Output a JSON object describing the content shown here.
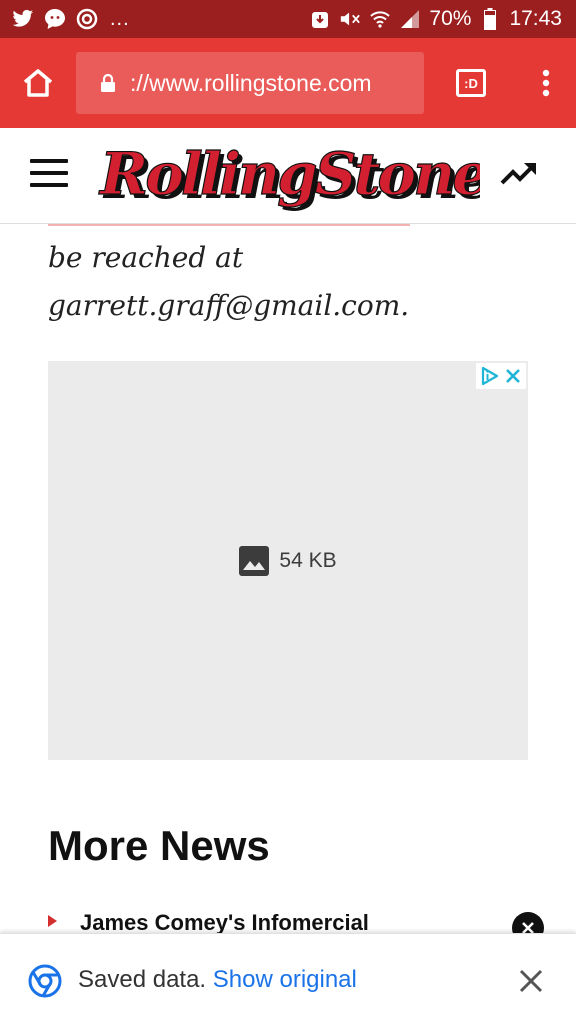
{
  "status_bar": {
    "battery": "70%",
    "time": "17:43",
    "more": "...",
    "left_icons": [
      "twitter-icon",
      "chat-icon",
      "sync-icon"
    ],
    "right_icons": [
      "download-icon",
      "mute-icon",
      "wifi-icon",
      "signal-icon",
      "battery-icon"
    ]
  },
  "browser": {
    "url": "://www.rollingstone.com",
    "tab_label": ":D",
    "toolbar_color": "#e53935",
    "status_color": "#9b1f1f"
  },
  "site": {
    "logo_text": "RollingStone"
  },
  "article": {
    "line1": "be reached at",
    "line2": "garrett.graff@gmail.com."
  },
  "ad": {
    "placeholder_size": "54 KB",
    "icons": [
      "adchoices-icon",
      "close-icon"
    ]
  },
  "more_news": {
    "heading": "More News",
    "items": [
      {
        "title": "James Comey's Infomercial"
      }
    ]
  },
  "infobar": {
    "message": "Saved data.",
    "link": "Show original",
    "link_color": "#1a73e8"
  }
}
